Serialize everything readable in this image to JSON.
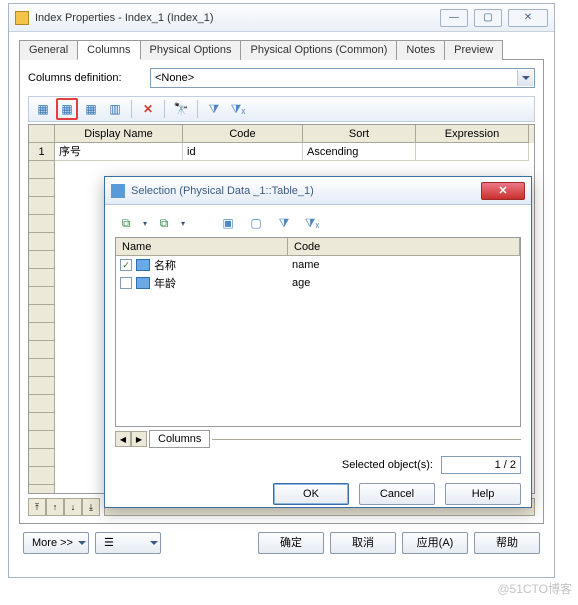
{
  "window": {
    "title": "Index Properties - Index_1 (Index_1)"
  },
  "tabs": {
    "general": "General",
    "columns": "Columns",
    "phys": "Physical Options",
    "phys_common": "Physical Options (Common)",
    "notes": "Notes",
    "preview": "Preview"
  },
  "def": {
    "label": "Columns definition:",
    "value": "<None>"
  },
  "toolbar_icons": {
    "i1": "grid-add-icon",
    "i2": "grid-open-icon",
    "i3": "grid-plain-icon",
    "i4": "grid-col-icon",
    "i5": "delete-icon",
    "i6": "find-icon",
    "i7": "filter-icon",
    "i8": "filter-clear-icon"
  },
  "grid": {
    "headers": {
      "name": "Display Name",
      "code": "Code",
      "sort": "Sort",
      "expr": "Expression"
    },
    "rows": [
      {
        "n": "1",
        "name": "序号",
        "code": "id",
        "sort": "Ascending",
        "expr": ""
      }
    ],
    "arrows": {
      "top": "⤒",
      "up": "↑",
      "down": "↓",
      "bottom": "⤓"
    }
  },
  "footer": {
    "more": "More >>",
    "ok": "确定",
    "cancel": "取消",
    "apply": "应用(A)",
    "help": "帮助"
  },
  "dialog": {
    "title": "Selection (Physical Data _1::Table_1)",
    "head": {
      "name": "Name",
      "code": "Code"
    },
    "rows": [
      {
        "checked": true,
        "name": "名称",
        "code": "name"
      },
      {
        "checked": false,
        "name": "年龄",
        "code": "age"
      }
    ],
    "tab": "Columns",
    "selected_label": "Selected object(s):",
    "selected_value": "1 / 2",
    "ok": "OK",
    "cancel": "Cancel",
    "help": "Help"
  },
  "watermark": "@51CTO博客"
}
